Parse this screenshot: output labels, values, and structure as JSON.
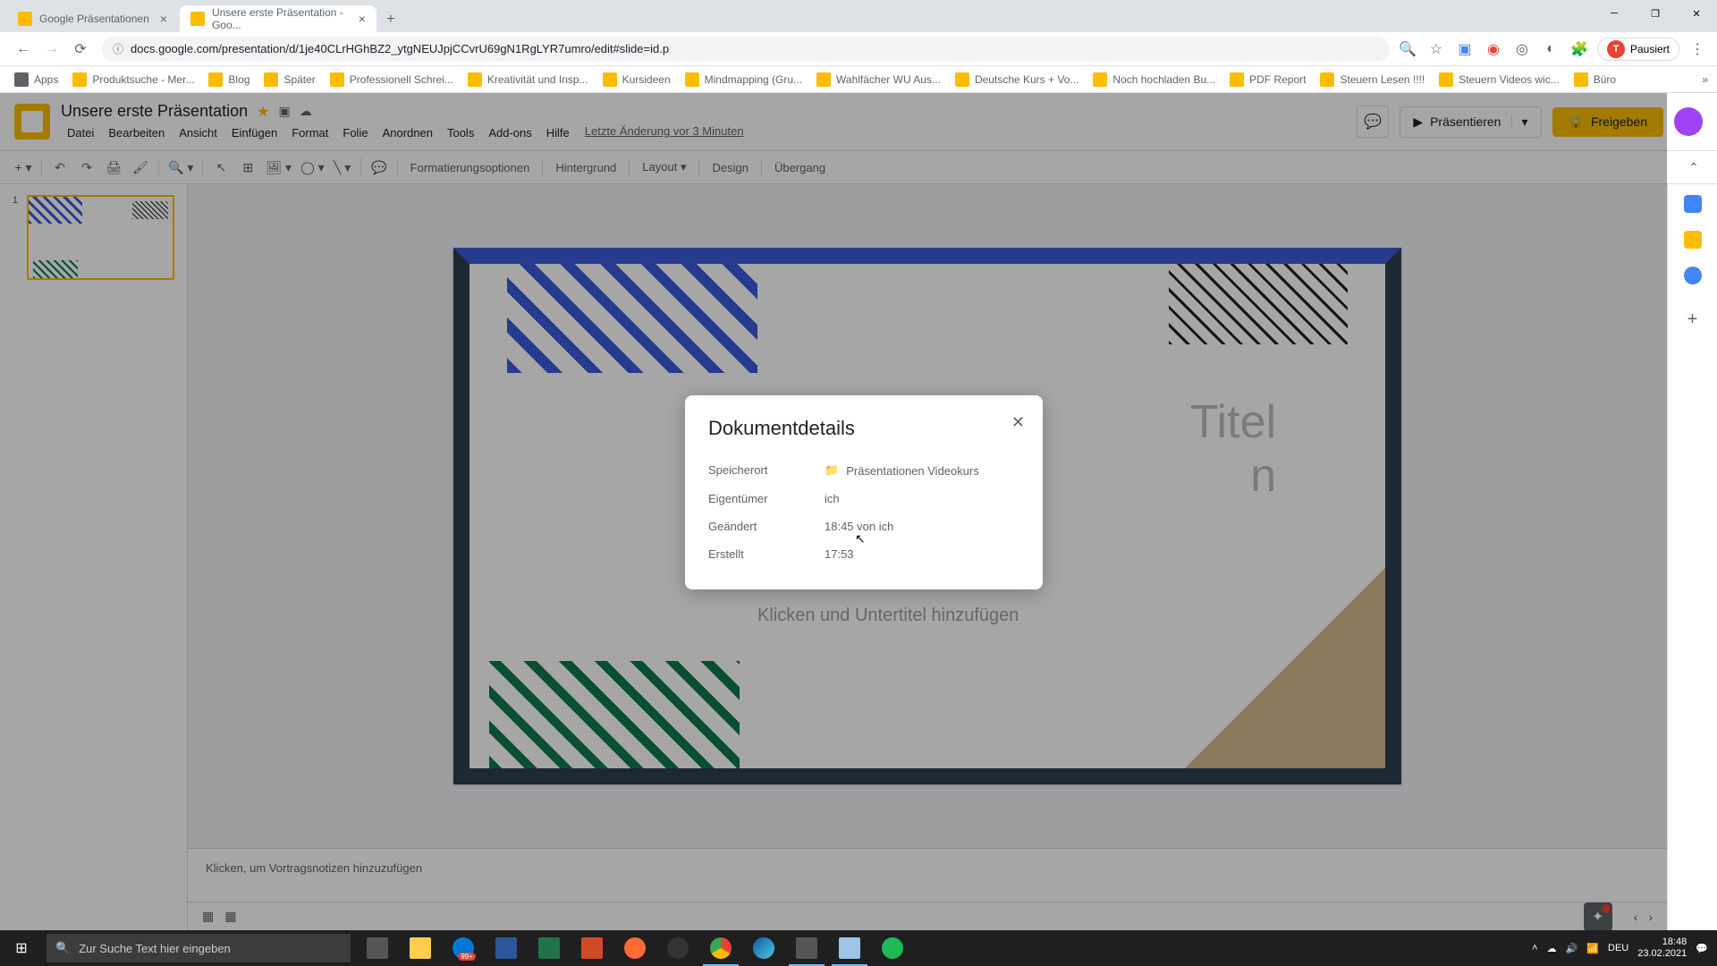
{
  "browser": {
    "tabs": [
      {
        "title": "Google Präsentationen"
      },
      {
        "title": "Unsere erste Präsentation - Goo..."
      }
    ],
    "url": "docs.google.com/presentation/d/1je40CLrHGhBZ2_ytgNEUJpjCCvrU69gN1RgLYR7umro/edit#slide=id.p",
    "paused": "Pausiert",
    "bookmarks": [
      "Apps",
      "Produktsuche - Mer...",
      "Blog",
      "Später",
      "Professionell Schrei...",
      "Kreativität und Insp...",
      "Kursideen",
      "Mindmapping (Gru...",
      "Wahlfächer WU Aus...",
      "Deutsche Kurs + Vo...",
      "Noch hochladen Bu...",
      "PDF Report",
      "Steuern Lesen !!!!",
      "Steuern Videos wic...",
      "Büro"
    ]
  },
  "app": {
    "title": "Unsere erste Präsentation",
    "menus": [
      "Datei",
      "Bearbeiten",
      "Ansicht",
      "Einfügen",
      "Format",
      "Folie",
      "Anordnen",
      "Tools",
      "Add-ons",
      "Hilfe"
    ],
    "last_edit": "Letzte Änderung vor 3 Minuten",
    "present": "Präsentieren",
    "share": "Freigeben"
  },
  "toolbar": {
    "format_options": "Formatierungsoptionen",
    "background": "Hintergrund",
    "layout": "Layout",
    "design": "Design",
    "transition": "Übergang"
  },
  "slide": {
    "number": "1",
    "title_placeholder": "Titel",
    "title_line2": "n",
    "subtitle_placeholder": "Klicken und Untertitel hinzufügen"
  },
  "notes": {
    "placeholder": "Klicken, um Vortragsnotizen hinzuzufügen"
  },
  "modal": {
    "title": "Dokumentdetails",
    "rows": {
      "location_label": "Speicherort",
      "location_value": "Präsentationen Videokurs",
      "owner_label": "Eigentümer",
      "owner_value": "ich",
      "modified_label": "Geändert",
      "modified_value": "18:45 von ich",
      "created_label": "Erstellt",
      "created_value": "17:53"
    }
  },
  "taskbar": {
    "search": "Zur Suche Text hier eingeben",
    "lang": "DEU",
    "time": "18:48",
    "date": "23.02.2021",
    "badge": "99+"
  }
}
